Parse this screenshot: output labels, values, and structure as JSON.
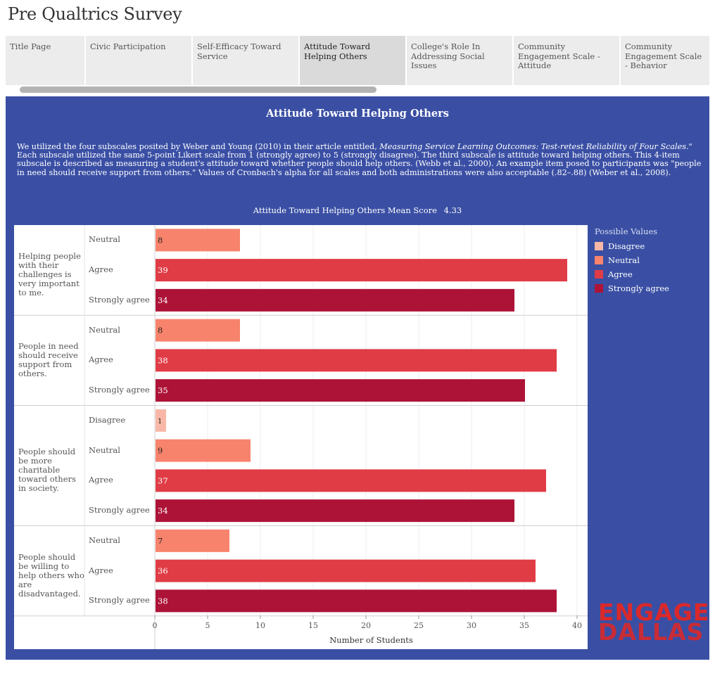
{
  "page_title": "Pre Qualtrics Survey",
  "tabs": [
    {
      "label": "Title Page",
      "active": false
    },
    {
      "label": "Civic Participation",
      "active": false
    },
    {
      "label": "Self-Efficacy Toward Service",
      "active": false
    },
    {
      "label": "Attitude Toward Helping Others",
      "active": true
    },
    {
      "label": "College's Role In Addressing Social Issues",
      "active": false
    },
    {
      "label": "Community Engagement Scale - Attitude",
      "active": false
    },
    {
      "label": "Community Engagement Scale - Behavior",
      "active": false
    }
  ],
  "panel": {
    "title": "Attitude Toward Helping Others",
    "intro_part1": "We utilized the four subscales posited by Weber and Young (2010) in their article entitled, ",
    "intro_italic": "Measuring Service Learning Outcomes: Test-retest Reliability of Four Scales",
    "intro_part2": ".\" Each subscale utilized the same 5-point Likert scale from 1 (strongly agree) to 5 (strongly disagree). The third subscale is attitude toward helping others. This 4-item subscale is described as measuring a student's attitude toward whether people should help others. (Webb et al., 2000). An example item posed to participants was \"people in need should receive support from others.\"  Values of Cronbach's alpha for all scales and both administrations were also acceptable (.82–.88) (Weber et al., 2008).",
    "mean_label": "Attitude Toward Helping Others Mean Score",
    "mean_value": "4.33"
  },
  "colors": {
    "panel_bg": "#3a4fa4",
    "Disagree": "#f9b8a7",
    "Neutral": "#f7836d",
    "Agree": "#e03c46",
    "Strongly agree": "#ad1337"
  },
  "legend": {
    "title": "Possible Values",
    "items": [
      "Disagree",
      "Neutral",
      "Agree",
      "Strongly agree"
    ]
  },
  "chart_data": {
    "type": "bar",
    "orientation": "horizontal",
    "xlabel": "Number of Students",
    "xlim": [
      0,
      40
    ],
    "xticks": [
      0,
      5,
      10,
      15,
      20,
      25,
      30,
      35,
      40
    ],
    "groups": [
      {
        "question": "Helping people with their challenges is very important to me.",
        "bars": [
          {
            "response": "Neutral",
            "value": 8
          },
          {
            "response": "Agree",
            "value": 39
          },
          {
            "response": "Strongly agree",
            "value": 34
          }
        ]
      },
      {
        "question": "People in need should receive support from others.",
        "bars": [
          {
            "response": "Neutral",
            "value": 8
          },
          {
            "response": "Agree",
            "value": 38
          },
          {
            "response": "Strongly agree",
            "value": 35
          }
        ]
      },
      {
        "question": "People should be more charitable toward others in society.",
        "bars": [
          {
            "response": "Disagree",
            "value": 1
          },
          {
            "response": "Neutral",
            "value": 9
          },
          {
            "response": "Agree",
            "value": 37
          },
          {
            "response": "Strongly agree",
            "value": 34
          }
        ]
      },
      {
        "question": "People should be willing to help others who are disadvantaged.",
        "bars": [
          {
            "response": "Neutral",
            "value": 7
          },
          {
            "response": "Agree",
            "value": 36
          },
          {
            "response": "Strongly agree",
            "value": 38
          }
        ]
      }
    ]
  },
  "logo": {
    "line1": "ENGAGE",
    "line2": "DALLAS"
  }
}
